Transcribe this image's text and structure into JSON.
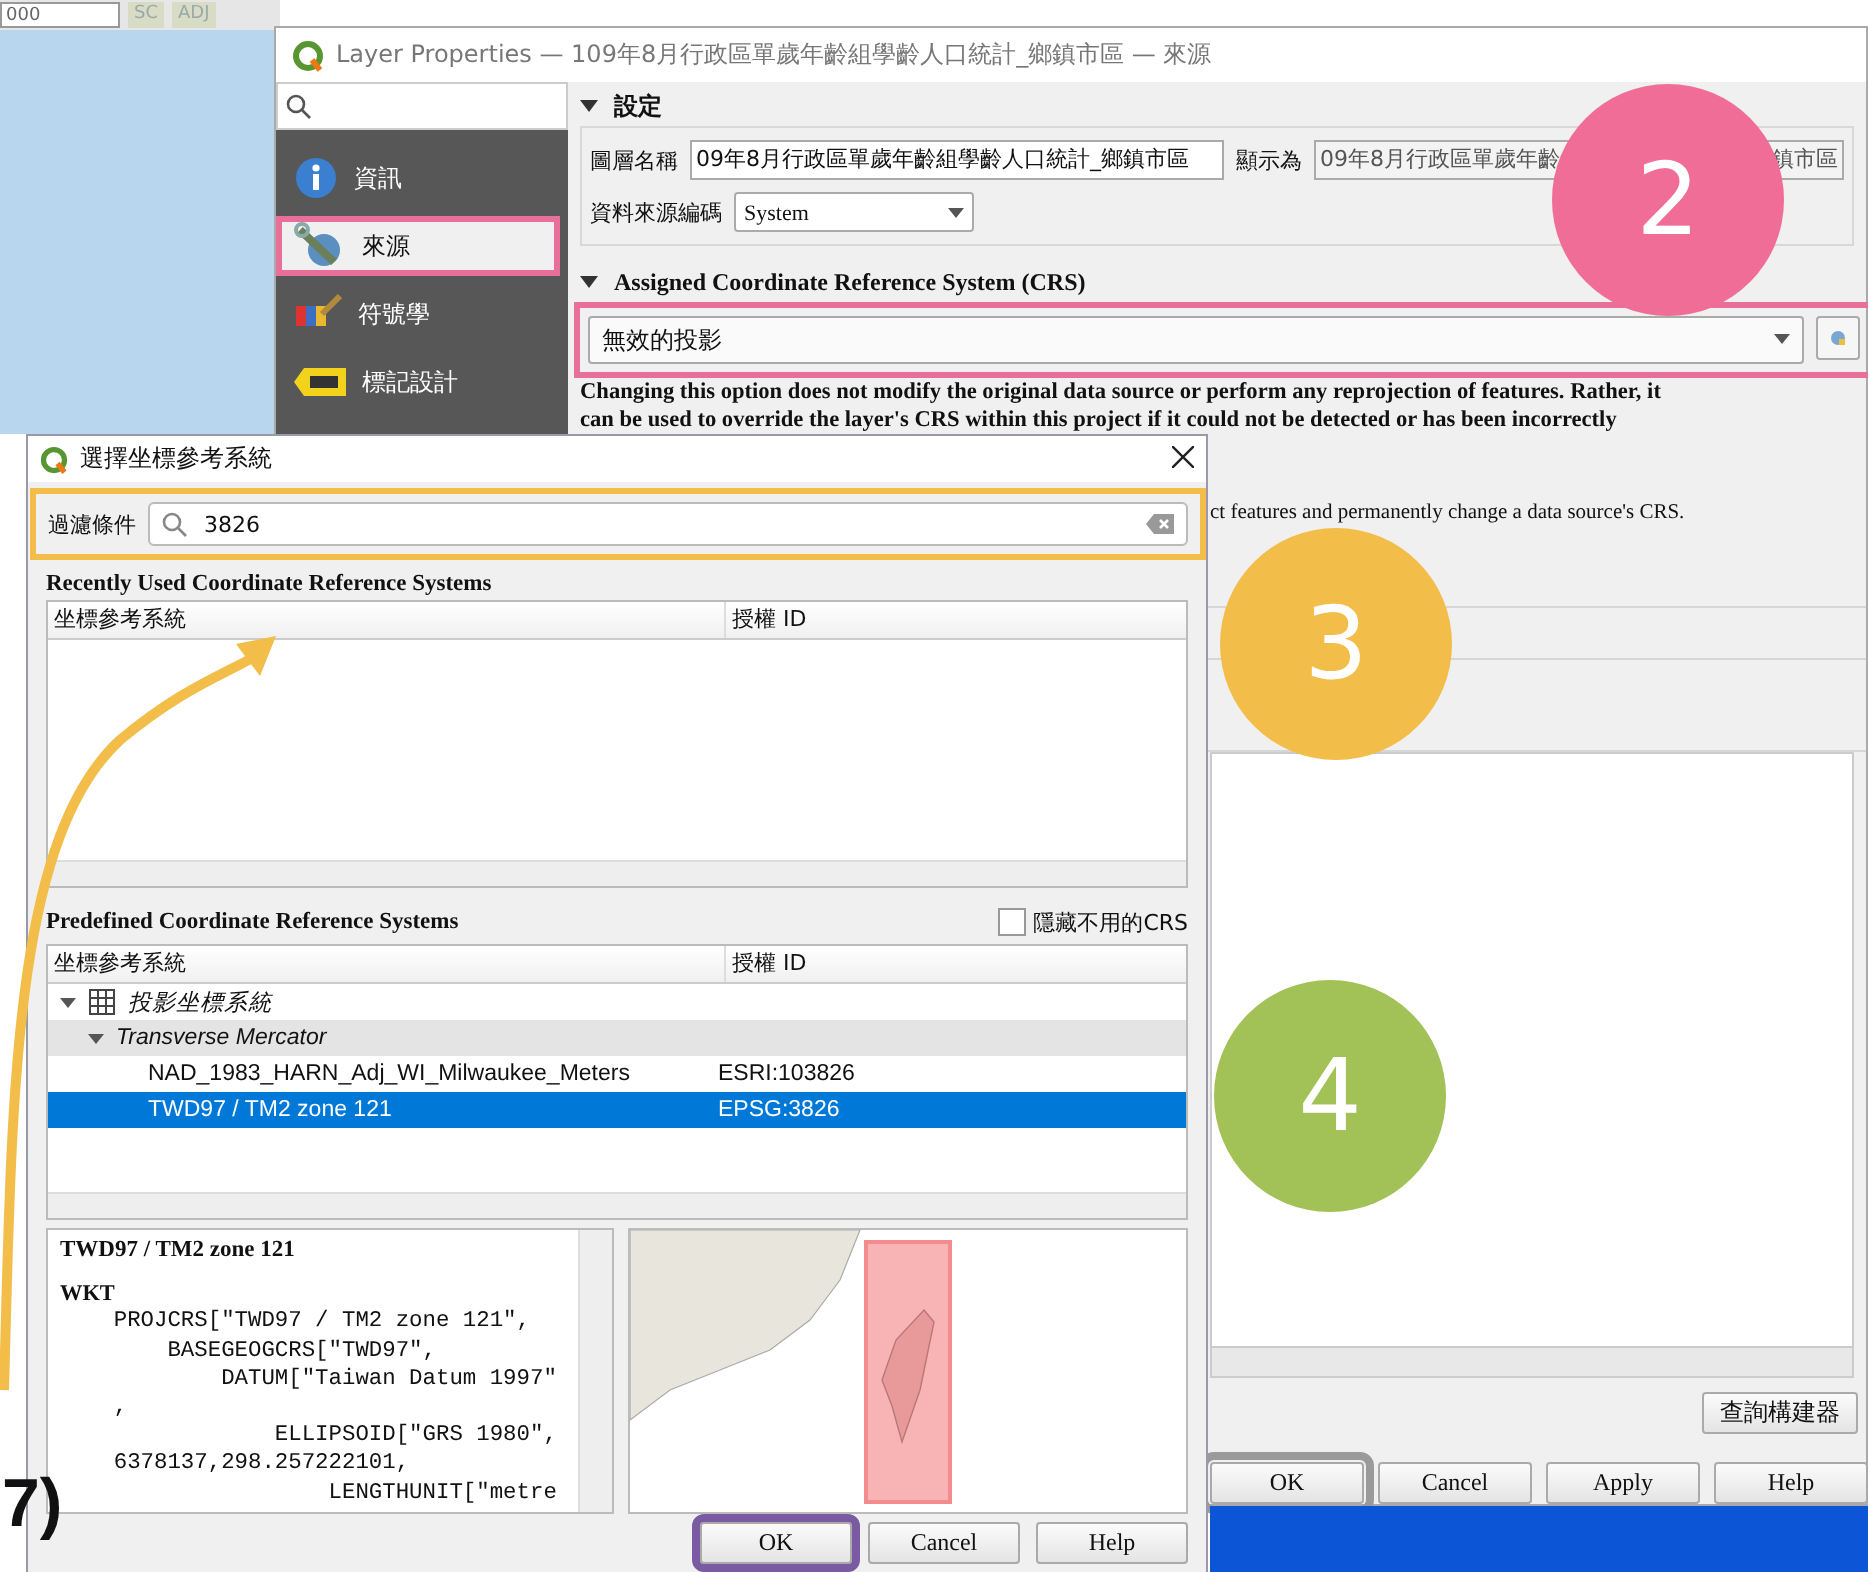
{
  "map_toolbar": {
    "scale": "000",
    "buttons": [
      "SC",
      "ADJ"
    ]
  },
  "layer_properties": {
    "title": "Layer Properties — 109年8月行政區單歲年齡組學齡人口統計_鄉鎮市區 — 來源",
    "sidebar": [
      {
        "kind": "info",
        "label": "資訊",
        "selected": false
      },
      {
        "kind": "source",
        "label": "來源",
        "selected": true
      },
      {
        "kind": "symbology",
        "label": "符號學",
        "selected": false
      },
      {
        "kind": "labels",
        "label": "標記設計",
        "selected": false
      }
    ],
    "settings_header": "設定",
    "layer_name": {
      "label": "圖層名稱",
      "value": "09年8月行政區單歲年齡組學齡人口統計_鄉鎮市區"
    },
    "display_as": {
      "label": "顯示為",
      "value_start": "09年8月行政區單歲年齡",
      "value_end": "鎮市區"
    },
    "encoding": {
      "label": "資料來源編碼",
      "value": "System"
    },
    "crs_header": "Assigned Coordinate Reference System (CRS)",
    "crs_value": "無效的投影",
    "description": [
      "Changing this option does not modify the original data source or perform any reprojection of features. Rather, it",
      "can be used to override the layer's CRS within this project if it could not be detected or has been incorrectly"
    ],
    "description_tail": "ct features and permanently change a data source's CRS.",
    "query_builder": "查詢構建器",
    "buttons": [
      "OK",
      "Cancel",
      "Apply",
      "Help"
    ]
  },
  "crs_dialog": {
    "title": "選擇坐標參考系統",
    "filter": {
      "label": "過濾條件",
      "value": "3826"
    },
    "recent_title": "Recently Used Coordinate Reference Systems",
    "recent_columns": [
      "坐標參考系統",
      "授權 ID"
    ],
    "predefined_title": "Predefined Coordinate Reference Systems",
    "hide_deprecated": {
      "label": "隱藏不用的CRS",
      "checked": false
    },
    "predefined_columns": [
      "坐標參考系統",
      "授權 ID"
    ],
    "tree": [
      {
        "label": "投影坐標系統",
        "expanded": true,
        "children": [
          {
            "label": "Transverse Mercator",
            "expanded": true,
            "children": [
              {
                "label": "NAD_1983_HARN_Adj_WI_Milwaukee_Meters",
                "authority": "ESRI:103826",
                "selected": false
              },
              {
                "label": "TWD97 / TM2 zone 121",
                "authority": "EPSG:3826",
                "selected": true
              }
            ]
          }
        ]
      }
    ],
    "wkt_title": "TWD97 / TM2 zone 121",
    "wkt_heading": "WKT",
    "wkt_lines": [
      "    PROJCRS[\"TWD97 / TM2 zone 121\",",
      "        BASEGEOGCRS[\"TWD97\",",
      "            DATUM[\"Taiwan Datum 1997\"",
      "    ,",
      "                ELLIPSOID[\"GRS 1980\",",
      "    6378137,298.257222101,",
      "                    LENGTHUNIT[\"metre"
    ],
    "buttons": [
      "OK",
      "Cancel",
      "Help"
    ]
  },
  "step_markers": [
    {
      "number": "2",
      "color": "#f06d97"
    },
    {
      "number": "3",
      "color": "#f2bd48"
    },
    {
      "number": "4",
      "color": "#a2c257"
    }
  ],
  "side_caption": "7)"
}
